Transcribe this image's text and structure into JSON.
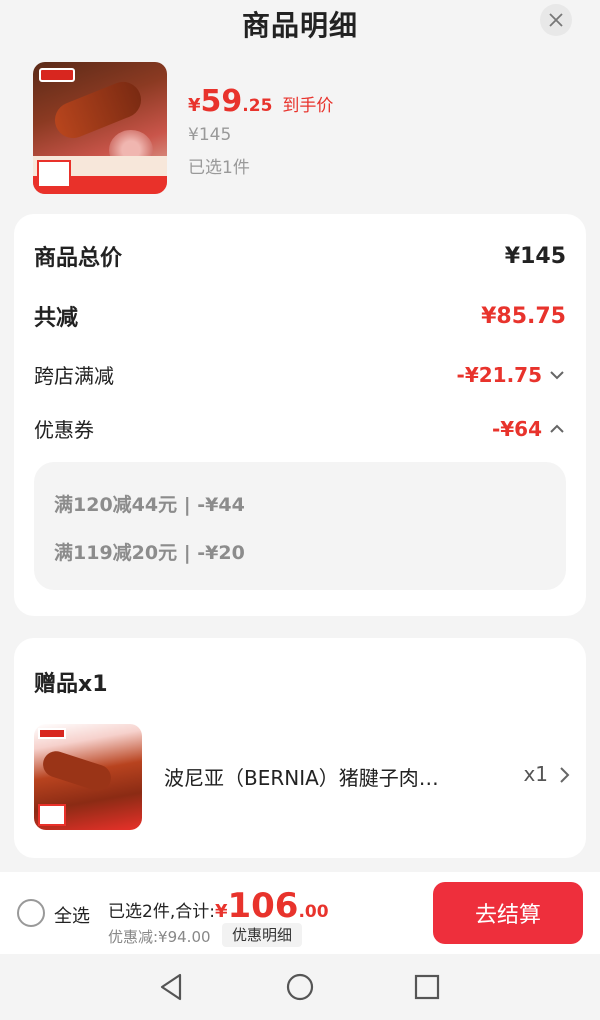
{
  "sheet": {
    "title": "商品明细"
  },
  "product": {
    "price_symbol": "¥",
    "price_int": "59",
    "price_dec": ".25",
    "price_label": "到手价",
    "original_price": "¥145",
    "selected_count": "已选1件"
  },
  "summary": {
    "total_label": "商品总价",
    "total_value": "¥145",
    "reduce_label": "共减",
    "reduce_value": "¥85.75",
    "cross_store_label": "跨店满减",
    "cross_store_value": "-¥21.75",
    "coupon_label": "优惠券",
    "coupon_value": "-¥64",
    "coupon_details": [
      "满120减44元 | -¥44",
      "满119减20元 | -¥20"
    ]
  },
  "gift": {
    "title": "赠品x1",
    "name": "波尼亚（BERNIA）猪腱子肉…",
    "qty": "x1"
  },
  "bottom_bar": {
    "select_all": "全选",
    "selected_text": "已选2件,合计:",
    "total_symbol": "¥",
    "total_int": "106",
    "total_dec": ".00",
    "discount_text": "优惠减:¥94.00",
    "discount_button": "优惠明细",
    "checkout_button": "去结算"
  },
  "colors": {
    "accent_red": "#e8332c",
    "checkout_red": "#ee2f3c"
  }
}
